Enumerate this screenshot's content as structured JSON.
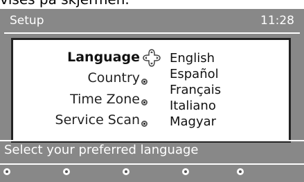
{
  "caption": "vises på skjermen.",
  "header": {
    "title": "Setup",
    "time": "11:28"
  },
  "menu": {
    "items": [
      {
        "label": "Language",
        "selected": true
      },
      {
        "label": "Country",
        "selected": false
      },
      {
        "label": "Time Zone",
        "selected": false
      },
      {
        "label": "Service Scan",
        "selected": false
      }
    ]
  },
  "options": [
    "English",
    "Español",
    "Français",
    "Italiano",
    "Magyar"
  ],
  "help": {
    "text": "Select your preferred language"
  },
  "colors": {
    "screen_background": "#888888",
    "panel_background": "#ffffff",
    "text_light": "#ffffff"
  },
  "icons": {
    "navigation": "navigation-cursor-icon"
  }
}
